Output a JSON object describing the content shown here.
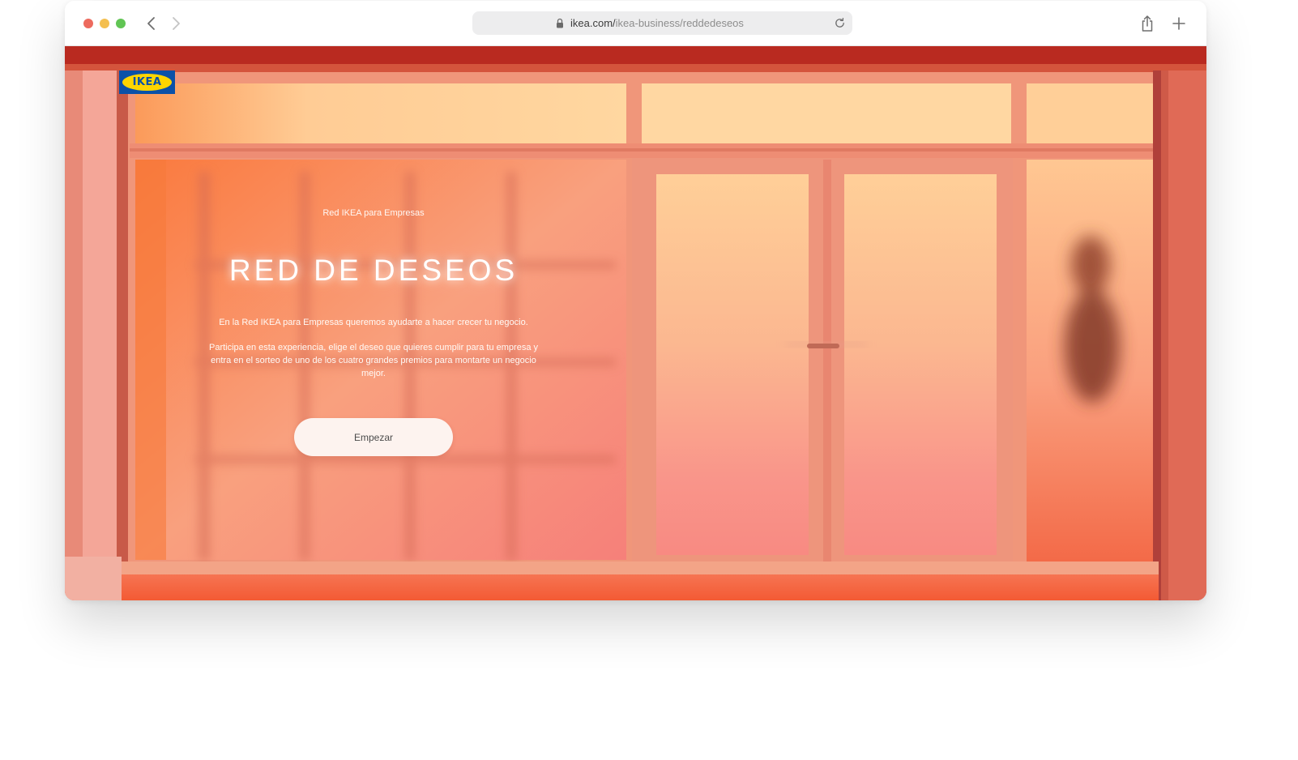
{
  "browser": {
    "url_host": "ikea.com/",
    "url_path": "ikea-business/reddedeseos"
  },
  "brand": {
    "logo_text": "IKEA",
    "colors": {
      "blue": "#0b51a8",
      "yellow": "#ffd500"
    }
  },
  "hero": {
    "eyebrow": "Red IKEA para Empresas",
    "title": "RED DE DESEOS",
    "paragraph_1": "En la Red IKEA para Empresas queremos ayudarte a hacer crecer tu negocio.",
    "paragraph_2": "Participa en esta experiencia, elige el deseo que quieres cumplir para tu empresa y entra en el sorteo de uno de los cuatro grandes premios para montarte un negocio mejor.",
    "cta_label": "Empezar"
  },
  "icons": {
    "back": "chevron-left-icon",
    "forward": "chevron-right-icon",
    "lock": "lock-icon",
    "reload": "reload-icon",
    "share": "share-icon",
    "new_tab": "plus-icon"
  }
}
